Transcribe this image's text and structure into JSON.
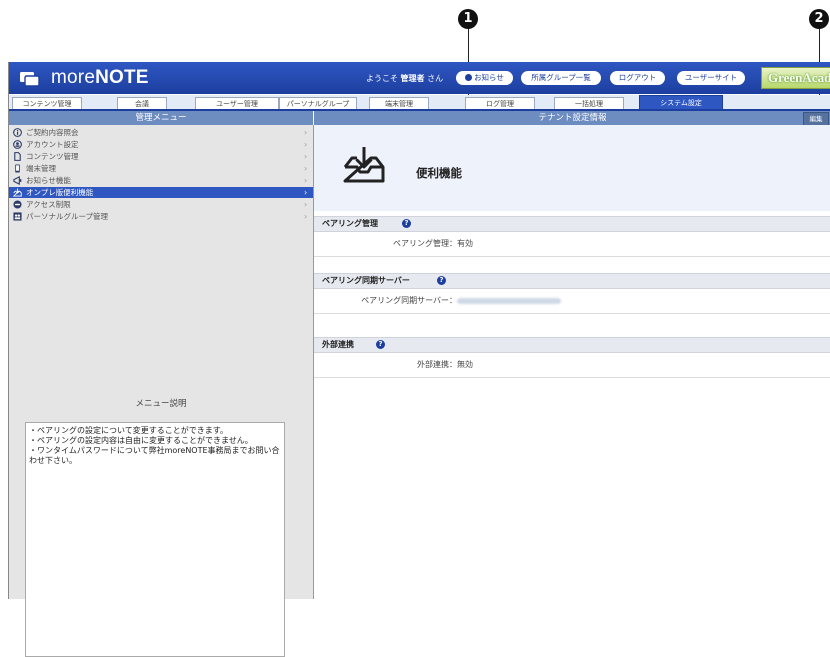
{
  "callouts": {
    "one": "1",
    "two": "2"
  },
  "header": {
    "logo_text_bold": "more",
    "logo_text_tail": "NOTE",
    "welcome_prefix": "ようこそ",
    "welcome_user": "管理者",
    "welcome_suffix": "さん",
    "btn_notice": "お知らせ",
    "btn_groups": "所属グループ一覧",
    "btn_logout": "ログアウト",
    "btn_user_site": "ユーザーサイト",
    "partner_logo": "GreenAcad"
  },
  "tabs": [
    {
      "label": "コンテンツ管理"
    },
    {
      "label": "会議"
    },
    {
      "label": "ユーザー管理"
    },
    {
      "label": "パーソナルグループ"
    },
    {
      "label": "端末管理"
    },
    {
      "label": "ログ管理"
    },
    {
      "label": "一括処理"
    },
    {
      "label": "システム設定"
    }
  ],
  "sidebar": {
    "title": "管理メニュー",
    "items": [
      {
        "label": "ご契約内容照会"
      },
      {
        "label": "アカウント設定"
      },
      {
        "label": "コンテンツ管理"
      },
      {
        "label": "端末管理"
      },
      {
        "label": "お知らせ機能"
      },
      {
        "label": "オンプレ版便利機能"
      },
      {
        "label": "アクセス制限"
      },
      {
        "label": "パーソナルグループ管理"
      }
    ],
    "desc_title": "メニュー説明",
    "desc_lines": [
      "・ペアリングの設定について変更することができます。",
      "・ペアリングの設定内容は自由に変更することができません。",
      "・ワンタイムパスワードについて弊社moreNOTE事務局までお問い合わせ下さい。"
    ]
  },
  "main": {
    "title": "テナント設定情報",
    "edit_label": "編集",
    "feature_title": "便利機能",
    "sections": [
      {
        "title": "ペアリング管理",
        "key": "ペアリング管理：",
        "value": "有効"
      },
      {
        "title": "ペアリング同期サーバー",
        "key": "ペアリング同期サーバー：",
        "value": ""
      },
      {
        "title": "外部連携",
        "key": "外部連携：",
        "value": "無効"
      }
    ]
  }
}
